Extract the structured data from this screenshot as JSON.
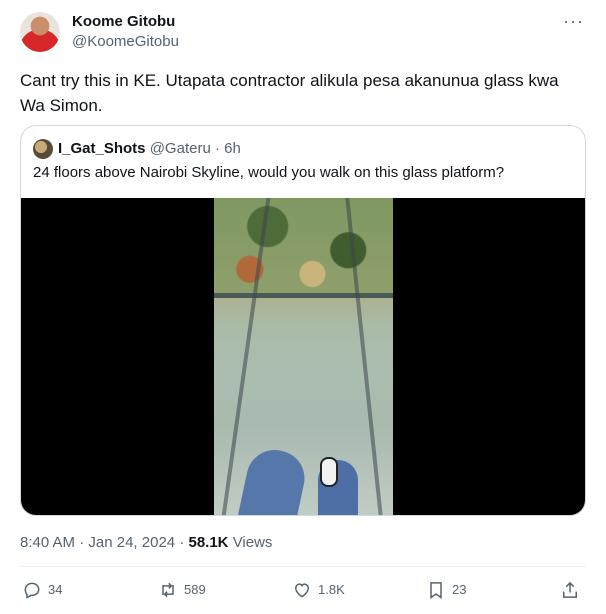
{
  "tweet": {
    "author_name": "Koome Gitobu",
    "author_handle": "@KoomeGitobu",
    "text": "Cant try this in KE. Utapata contractor alikula pesa akanunua glass kwa Wa Simon.",
    "more_icon": "more-horizontal-icon"
  },
  "quote": {
    "author_name": "I_Gat_Shots",
    "author_handle": "@Gateru",
    "separator": "·",
    "time": "6h",
    "text": "24 floors above Nairobi Skyline, would you walk on this glass platform?"
  },
  "meta": {
    "time": "8:40 AM",
    "separator1": "·",
    "date": "Jan 24, 2024",
    "separator2": "·",
    "views_count": "58.1K",
    "views_label": "Views"
  },
  "actions": {
    "replies": "34",
    "retweets": "589",
    "likes": "1.8K",
    "bookmarks": "23"
  },
  "colors": {
    "text_primary": "#0f1419",
    "text_secondary": "#536471",
    "border": "#cfd9de"
  }
}
